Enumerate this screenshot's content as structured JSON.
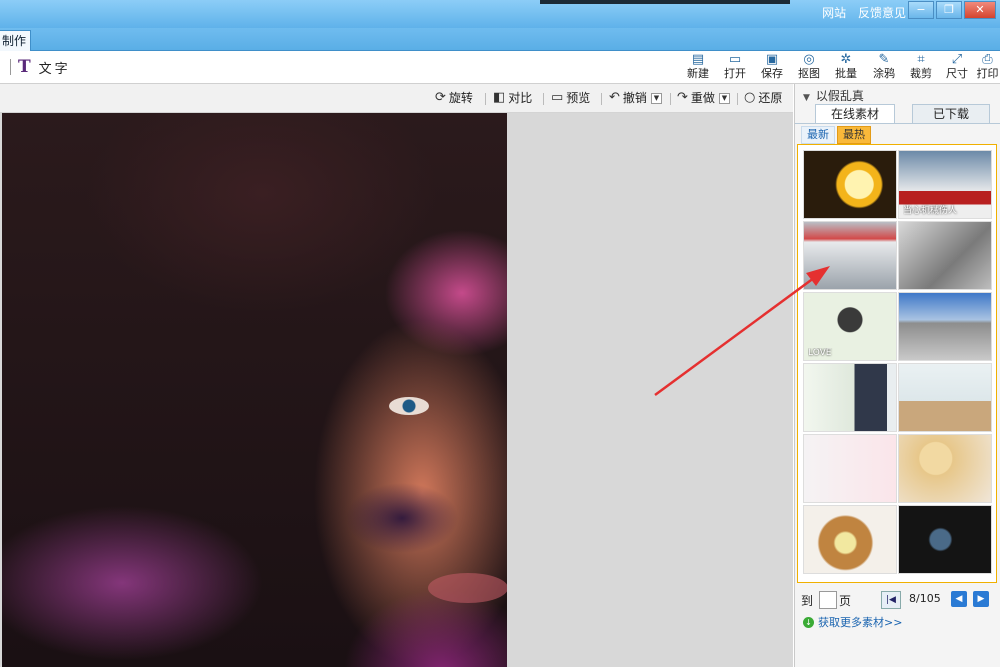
{
  "titlebar": {
    "link_site": "网站",
    "link_feedback": "反馈意见"
  },
  "tabbar": {
    "active_tab": "制作"
  },
  "toolbar": {
    "text_tool": "文字",
    "buttons": [
      "新建",
      "打开",
      "保存",
      "抠图",
      "批量",
      "涂鸦",
      "裁剪",
      "尺寸",
      "打印"
    ]
  },
  "editbar": {
    "rotate": "旋转",
    "compare": "对比",
    "preview": "预览",
    "undo": "撤销",
    "redo": "重做",
    "restore": "还原"
  },
  "right_panel": {
    "header": "以假乱真",
    "tab_online": "在线素材",
    "tab_downloaded": "已下载",
    "sub_newest": "最新",
    "sub_hottest": "最热",
    "thumb_captions": [
      "当心机械伤人",
      "",
      "",
      "",
      "",
      "LOVE",
      "",
      "",
      "",
      ""
    ],
    "pager": {
      "go": "到",
      "page_label": "页",
      "page_count": "8/105"
    },
    "more_link": "获取更多素材>>"
  },
  "colors": {
    "accent": "#5fb2ea",
    "arrow": "#e53030",
    "hot_tab": "#f9b93a",
    "grid_border": "#f0b000"
  }
}
